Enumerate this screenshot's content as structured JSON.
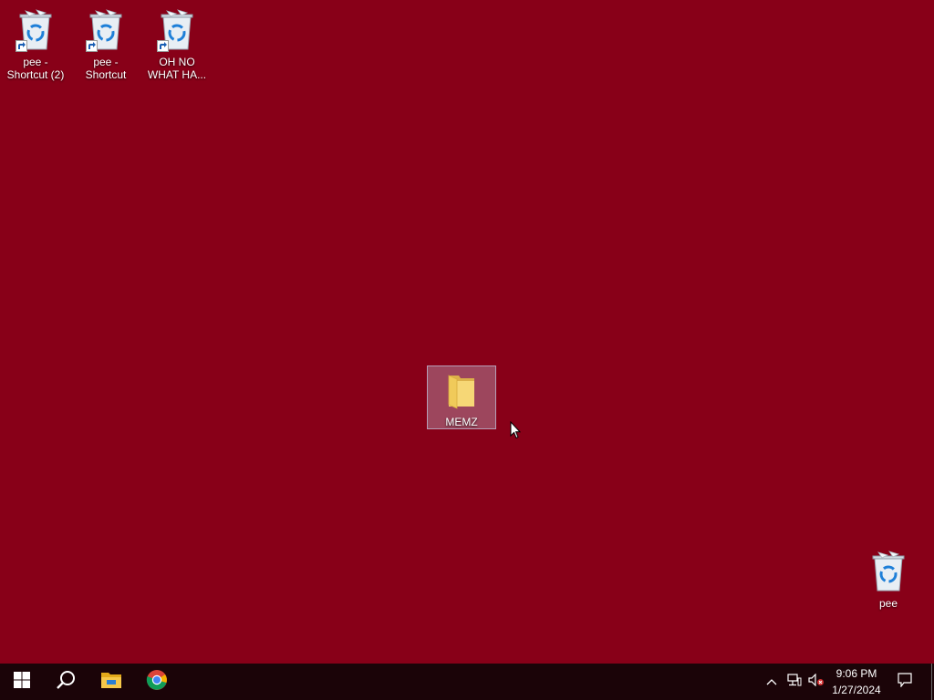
{
  "desktop": {
    "background_color": "#880018",
    "icons": [
      {
        "label": "pee -\nShortcut (2)",
        "type": "recycle-bin",
        "shortcut": true
      },
      {
        "label": "pee -\nShortcut",
        "type": "recycle-bin",
        "shortcut": true
      },
      {
        "label": "OH NO\nWHAT HA...",
        "type": "recycle-bin",
        "shortcut": true
      },
      {
        "label": "MEMZ",
        "type": "folder",
        "shortcut": false,
        "selected": true
      },
      {
        "label": "pee",
        "type": "recycle-bin",
        "shortcut": false
      }
    ]
  },
  "taskbar": {
    "pinned": [
      "windows-start-icon",
      "search-icon",
      "file-explorer-icon",
      "chrome-icon"
    ],
    "tray": {
      "time": "9:06 PM",
      "date": "1/27/2024"
    }
  }
}
